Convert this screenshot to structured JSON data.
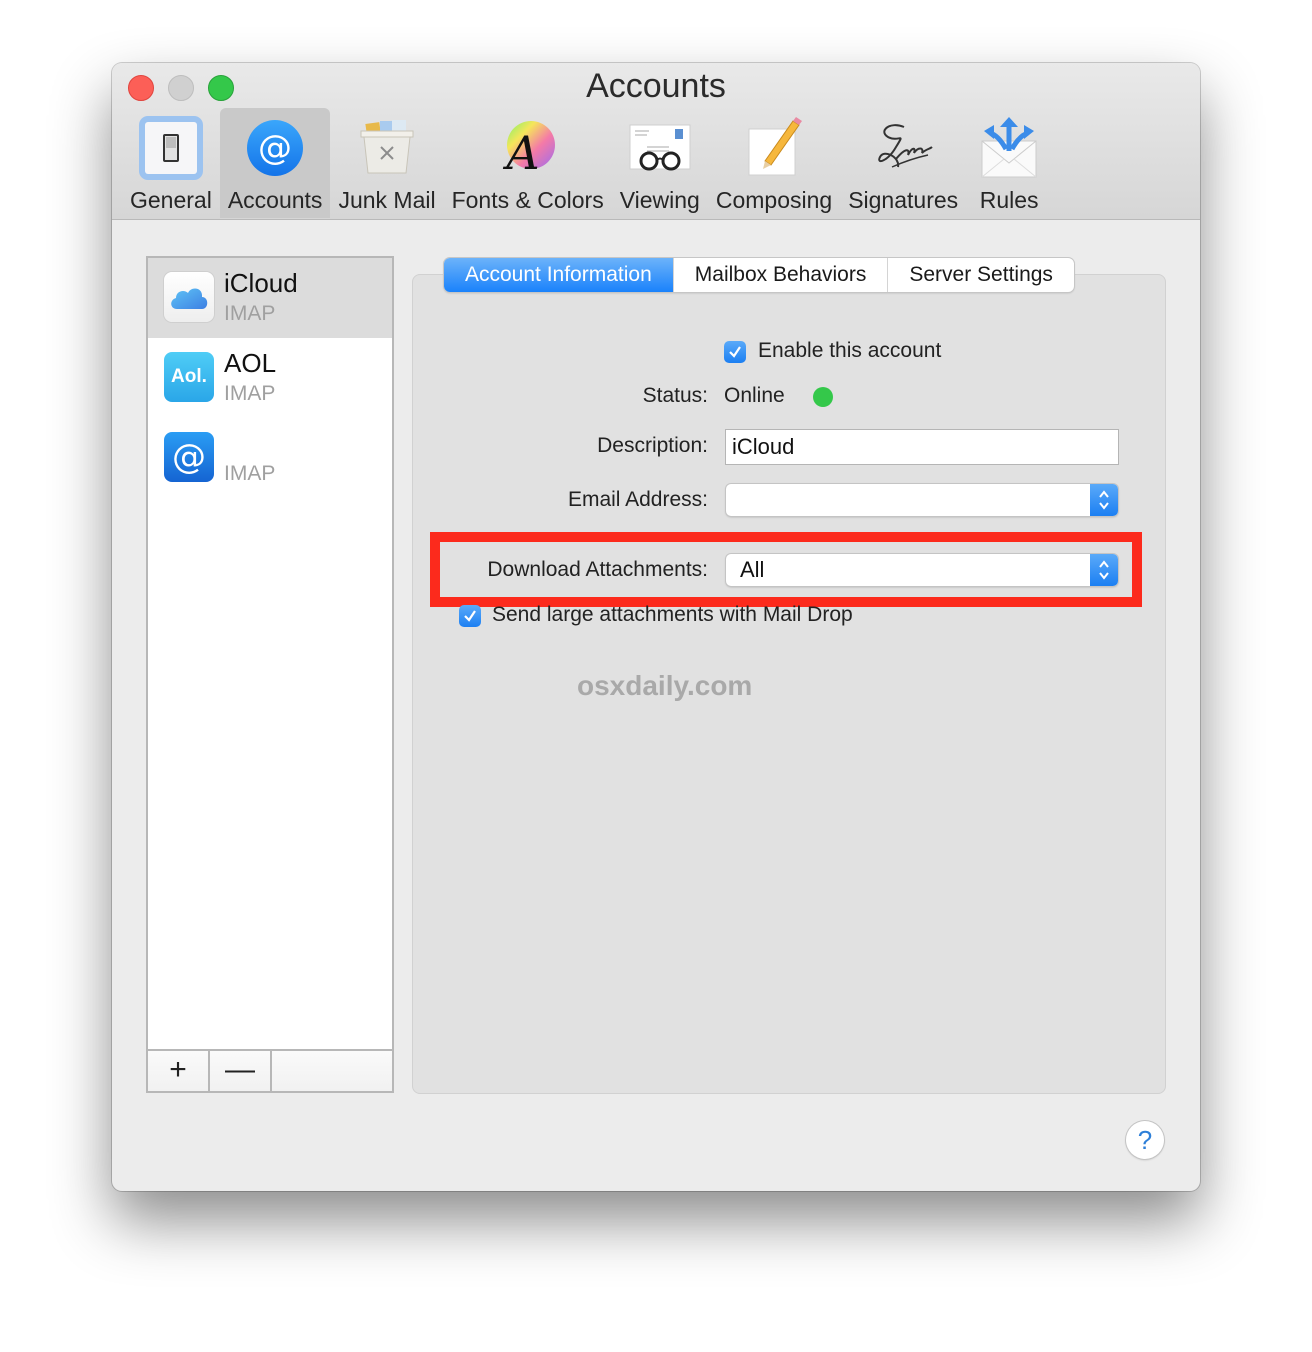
{
  "window": {
    "title": "Accounts",
    "traffic_lights": [
      "close",
      "minimize",
      "zoom"
    ]
  },
  "toolbar": {
    "items": [
      {
        "label": "General",
        "icon": "light-switch-icon",
        "selected": false
      },
      {
        "label": "Accounts",
        "icon": "at-sign-icon",
        "selected": true
      },
      {
        "label": "Junk Mail",
        "icon": "junk-bin-icon",
        "selected": false
      },
      {
        "label": "Fonts & Colors",
        "icon": "font-color-wheel-icon",
        "selected": false
      },
      {
        "label": "Viewing",
        "icon": "glasses-letter-icon",
        "selected": false
      },
      {
        "label": "Composing",
        "icon": "pencil-paper-icon",
        "selected": false
      },
      {
        "label": "Signatures",
        "icon": "signature-icon",
        "selected": false
      },
      {
        "label": "Rules",
        "icon": "envelope-arrows-icon",
        "selected": false
      }
    ]
  },
  "accounts": [
    {
      "name": "iCloud",
      "type": "IMAP",
      "icon": "icloud-icon",
      "selected": true
    },
    {
      "name": "AOL",
      "type": "IMAP",
      "icon": "aol-icon",
      "icon_text": "Aol.",
      "selected": false
    },
    {
      "name": "",
      "type": "IMAP",
      "icon": "at-sign-icon",
      "selected": false
    }
  ],
  "list_footer": {
    "add": "+",
    "remove": "—"
  },
  "tabs": [
    {
      "label": "Account Information",
      "active": true
    },
    {
      "label": "Mailbox Behaviors",
      "active": false
    },
    {
      "label": "Server Settings",
      "active": false
    }
  ],
  "form": {
    "enable_account": {
      "label": "Enable this account",
      "checked": true
    },
    "status": {
      "label": "Status:",
      "value": "Online",
      "color": "#34c84a"
    },
    "description": {
      "label": "Description:",
      "value": "iCloud"
    },
    "email": {
      "label": "Email Address:",
      "value": ""
    },
    "download_attachments": {
      "label": "Download Attachments:",
      "value": "All"
    },
    "mail_drop": {
      "label": "Send large attachments with Mail Drop",
      "checked": true
    }
  },
  "watermark": "osxdaily.com",
  "help": "?",
  "colors": {
    "accent": "#1a82fb",
    "highlight_box": "#fc2a1c",
    "status_online": "#34c84a"
  }
}
